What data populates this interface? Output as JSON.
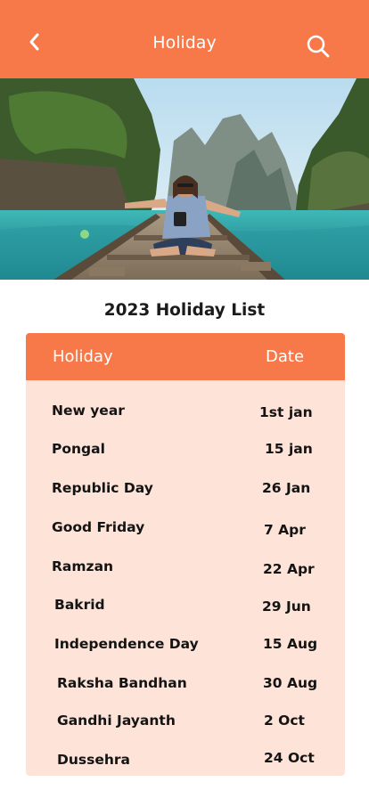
{
  "app_bar": {
    "title": "Holiday",
    "back_icon": "chevron-left-icon",
    "search_icon": "search-icon",
    "background": "#f7794a"
  },
  "hero": {
    "photo": "woman-sitting-on-boat-bow-in-turquoise-lagoon"
  },
  "holiday_list": {
    "title": "2023 Holiday List",
    "columns": [
      "Holiday",
      "Date"
    ],
    "header_color": "#f7794a",
    "body_color": "#fde3d8",
    "rows": [
      {
        "name": "New year",
        "date": "1st jan"
      },
      {
        "name": "Pongal",
        "date": "15 jan"
      },
      {
        "name": "Republic Day",
        "date": "26 Jan"
      },
      {
        "name": "Good Friday",
        "date": "7 Apr"
      },
      {
        "name": "Ramzan",
        "date": "22 Apr"
      },
      {
        "name": "Bakrid",
        "date": "29 Jun"
      },
      {
        "name": "Independence Day",
        "date": "15 Aug"
      },
      {
        "name": "Raksha Bandhan",
        "date": "30 Aug"
      },
      {
        "name": "Gandhi Jayanth",
        "date": "2 Oct"
      },
      {
        "name": "Dussehra",
        "date": "24 Oct"
      }
    ]
  }
}
